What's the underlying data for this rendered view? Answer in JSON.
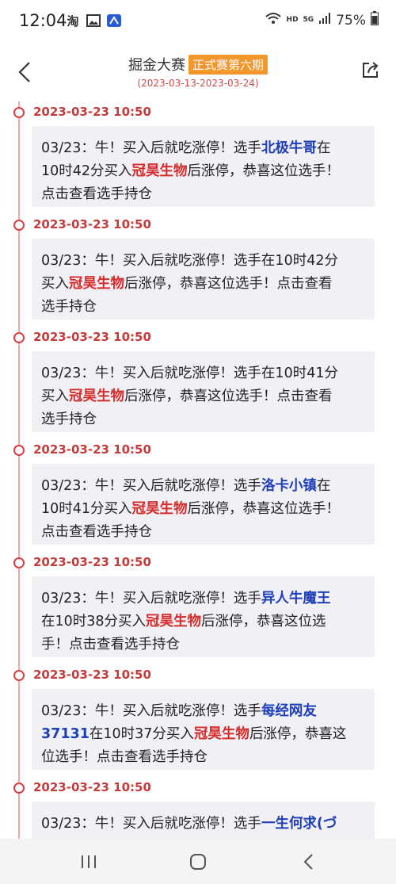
{
  "status": {
    "time": "12:04",
    "hd": "HD",
    "net": "5G",
    "battery": "75%"
  },
  "header": {
    "title": "掘金大赛",
    "badge": "正式赛第六期",
    "subtitle": "(2023-03-13-2023-03-24)"
  },
  "feed": [
    {
      "time": "2023-03-23 10:50",
      "lines": [
        [
          [
            "03/23：牛！买入后就吃涨停！选手",
            ""
          ],
          [
            "北极牛哥",
            "blue"
          ],
          [
            "在",
            ""
          ]
        ],
        [
          [
            "10时42分买入",
            ""
          ],
          [
            "冠昊生物",
            "red"
          ],
          [
            "后涨停，恭喜这位选手！",
            ""
          ]
        ],
        [
          [
            "点击查看选手持仓",
            ""
          ]
        ]
      ]
    },
    {
      "time": "2023-03-23 10:50",
      "lines": [
        [
          [
            "03/23：牛！买入后就吃涨停！选手在10时42分",
            ""
          ]
        ],
        [
          [
            "买入",
            ""
          ],
          [
            "冠昊生物",
            "red"
          ],
          [
            "后涨停，恭喜这位选手！点击查看",
            ""
          ]
        ],
        [
          [
            "选手持仓",
            ""
          ]
        ]
      ]
    },
    {
      "time": "2023-03-23 10:50",
      "lines": [
        [
          [
            "03/23：牛！买入后就吃涨停！选手在10时41分",
            ""
          ]
        ],
        [
          [
            "买入",
            ""
          ],
          [
            "冠昊生物",
            "red"
          ],
          [
            "后涨停，恭喜这位选手！点击查看",
            ""
          ]
        ],
        [
          [
            "选手持仓",
            ""
          ]
        ]
      ]
    },
    {
      "time": "2023-03-23 10:50",
      "lines": [
        [
          [
            "03/23：牛！买入后就吃涨停！选手",
            ""
          ],
          [
            "洛卡小镇",
            "blue"
          ],
          [
            "在",
            ""
          ]
        ],
        [
          [
            "10时41分买入",
            ""
          ],
          [
            "冠昊生物",
            "red"
          ],
          [
            "后涨停，恭喜这位选手！",
            ""
          ]
        ],
        [
          [
            "点击查看选手持仓",
            ""
          ]
        ]
      ]
    },
    {
      "time": "2023-03-23 10:50",
      "lines": [
        [
          [
            "03/23：牛！买入后就吃涨停！选手",
            ""
          ],
          [
            "异人牛魔王",
            "blue"
          ]
        ],
        [
          [
            "在10时38分买入",
            ""
          ],
          [
            "冠昊生物",
            "red"
          ],
          [
            "后涨停，恭喜这位选",
            ""
          ]
        ],
        [
          [
            "手！点击查看选手持仓",
            ""
          ]
        ]
      ]
    },
    {
      "time": "2023-03-23 10:50",
      "lines": [
        [
          [
            "03/23：牛！买入后就吃涨停！选手",
            ""
          ],
          [
            "每经网友",
            "blue"
          ]
        ],
        [
          [
            "37131",
            "blue"
          ],
          [
            "在10时37分买入",
            ""
          ],
          [
            "冠昊生物",
            "red"
          ],
          [
            "后涨停，恭喜这",
            ""
          ]
        ],
        [
          [
            "位选手！点击查看选手持仓",
            ""
          ]
        ]
      ]
    },
    {
      "time": "2023-03-23 10:50",
      "lines": [
        [
          [
            "03/23：牛！买入后就吃涨停！选手",
            ""
          ],
          [
            "一生何求(づ",
            "blue"
          ]
        ]
      ]
    }
  ],
  "colors": {
    "accent": "#d84040",
    "badge": "#f3962b",
    "blue_name": "#1f3fb8",
    "red_stock": "#d62b2b"
  }
}
